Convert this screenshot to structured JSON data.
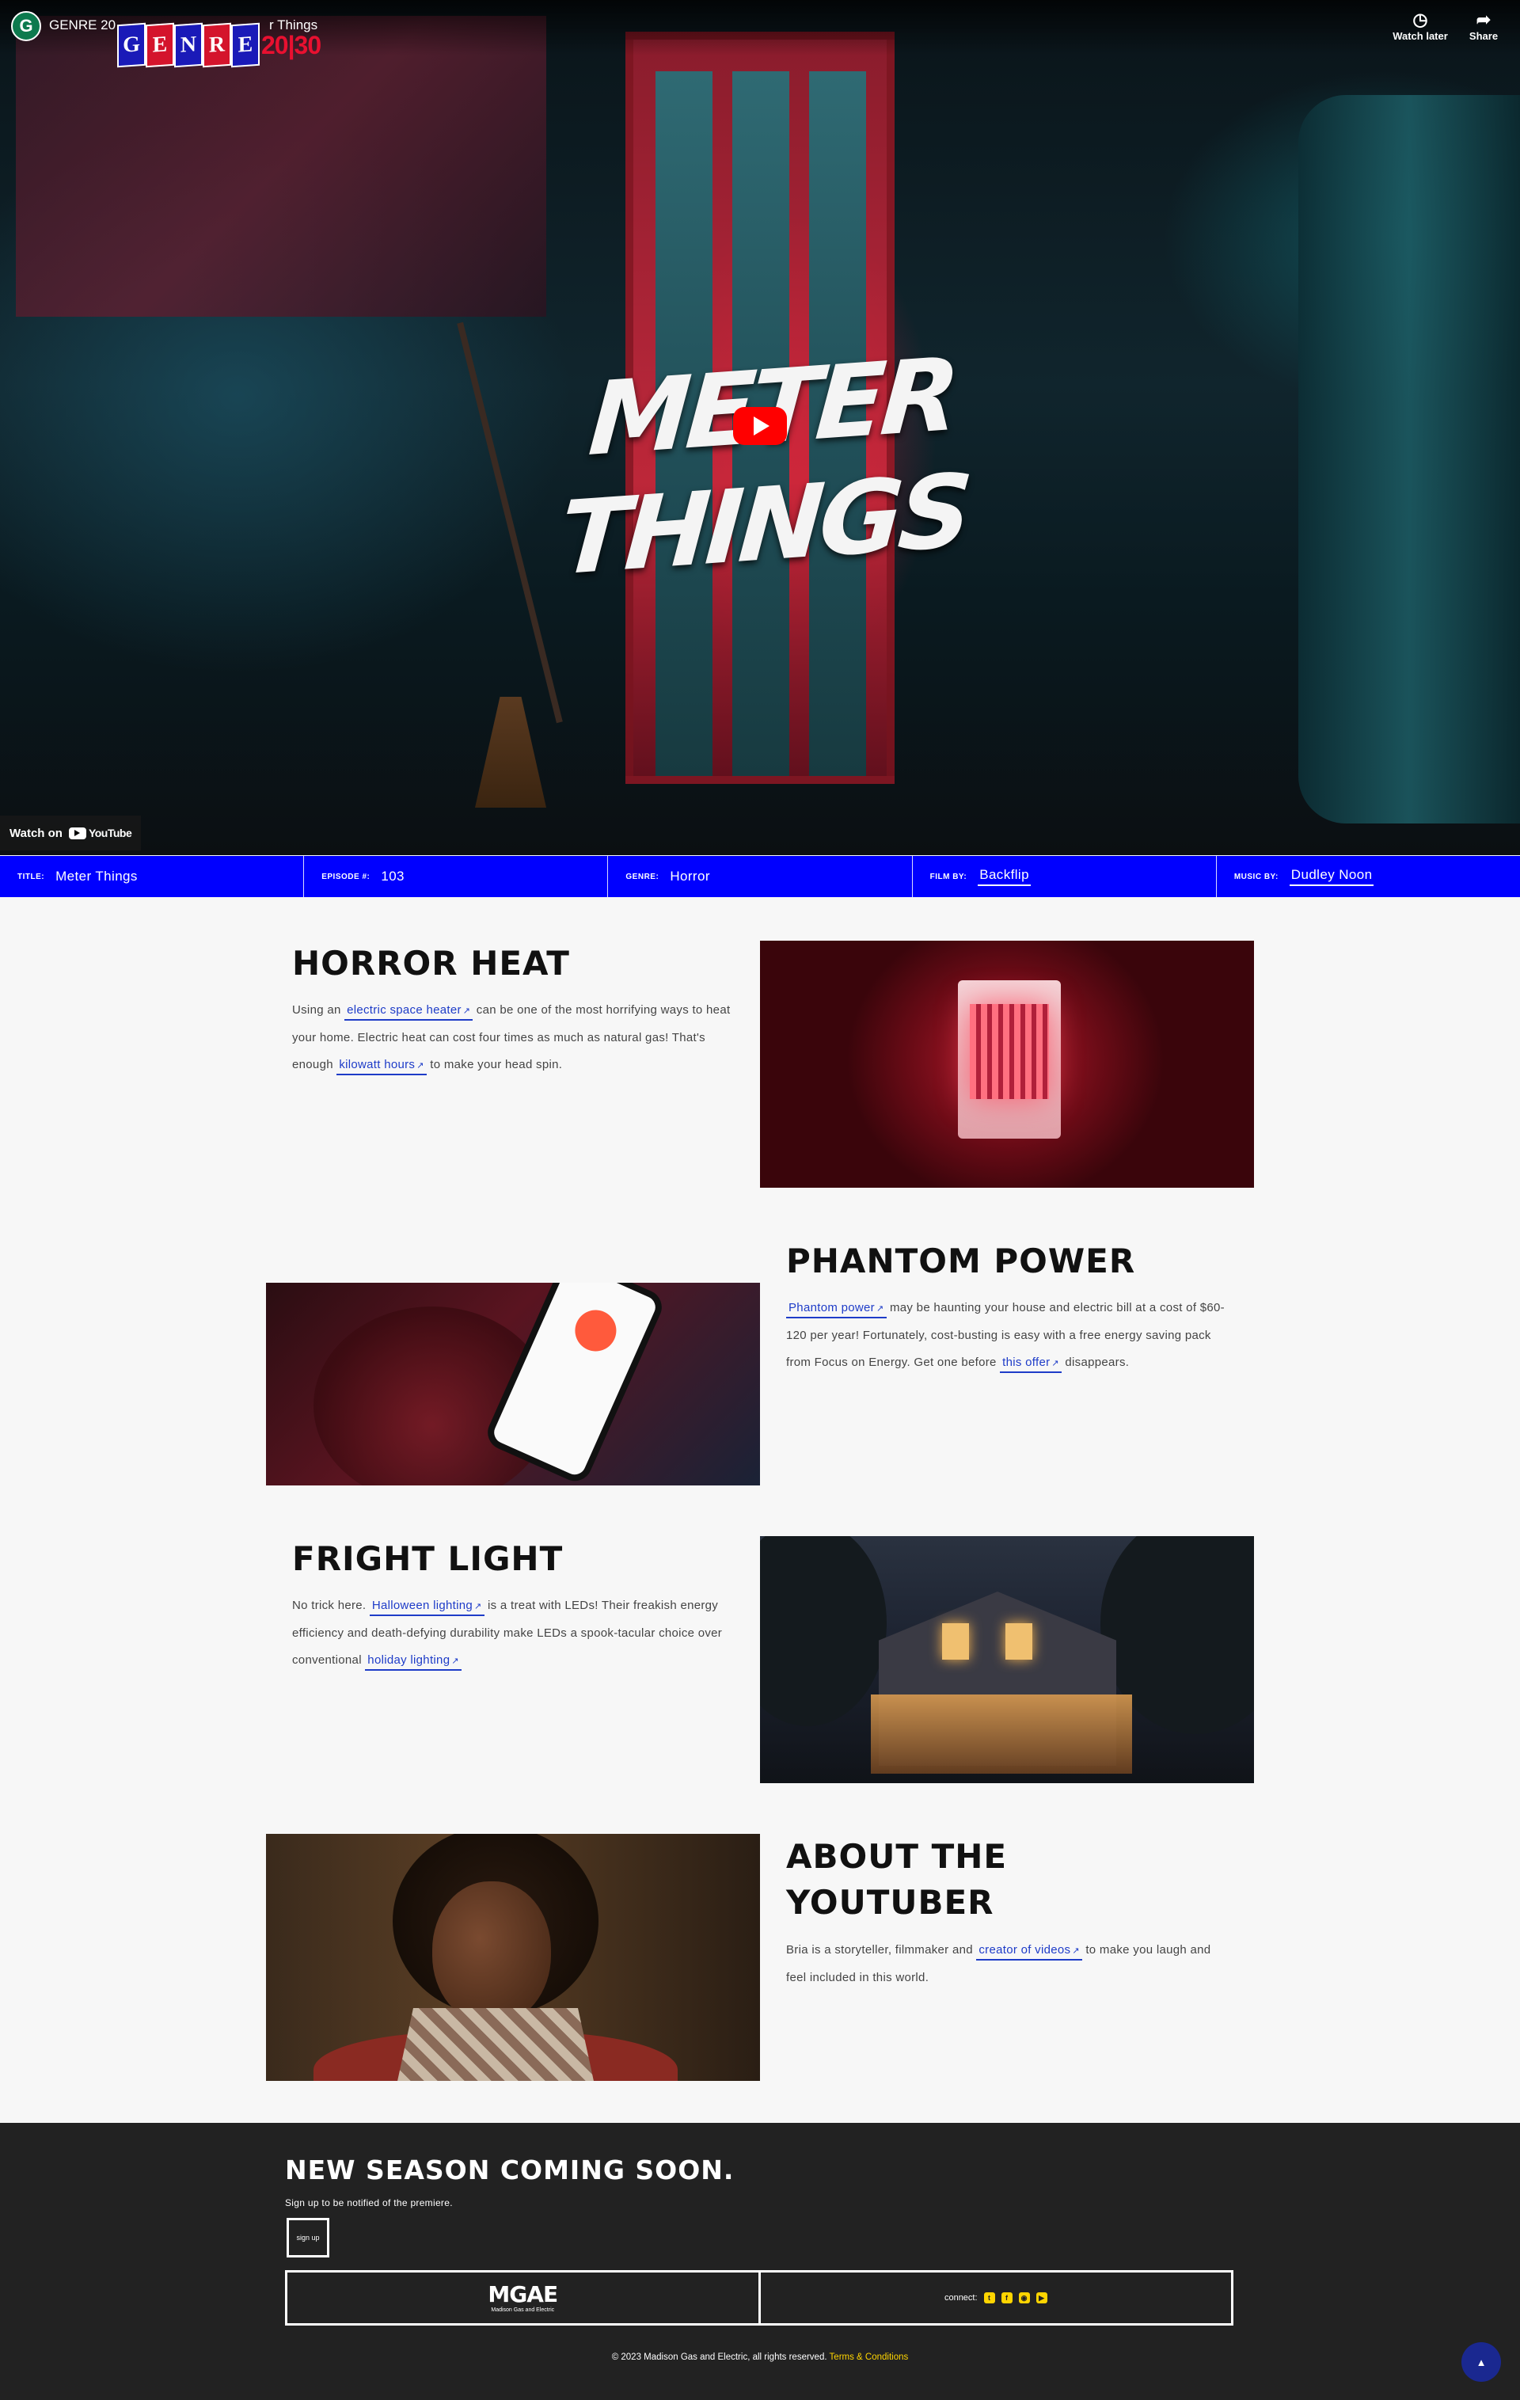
{
  "video": {
    "channel_initial": "G",
    "title_prefix": "GENRE 20",
    "title_suffix": "r Things",
    "genre_logo_letters": [
      "G",
      "E",
      "N",
      "R",
      "E"
    ],
    "genre_logo_year": "20|30",
    "watch_later": "Watch later",
    "share": "Share",
    "overlay_title": "METER THINGS",
    "watch_on": "Watch on",
    "youtube": "YouTube"
  },
  "info_bar": [
    {
      "label": "TITLE:",
      "value": "Meter Things",
      "is_link": false
    },
    {
      "label": "EPISODE #:",
      "value": "103",
      "is_link": false
    },
    {
      "label": "GENRE:",
      "value": "Horror",
      "is_link": false
    },
    {
      "label": "FILM BY:",
      "value": "Backflip",
      "is_link": true
    },
    {
      "label": "MUSIC BY:",
      "value": "Dudley Noon",
      "is_link": true
    }
  ],
  "sections": {
    "horror_heat": {
      "heading": "HORROR HEAT",
      "t1": "Using an ",
      "link1": "electric space heater",
      "t2": " can be one of the most horrifying ways to heat your home. Electric heat can cost four times as much as natural gas! That's enough ",
      "link2": "kilowatt hours",
      "t3": " to make your head spin."
    },
    "phantom_power": {
      "heading": "PHANTOM POWER",
      "link1": "Phantom power",
      "t1": " may be haunting your house and electric bill at a cost of $60-120 per year! Fortunately, cost-busting is easy with a free energy saving pack from Focus on Energy. Get one before ",
      "link2": "this offer",
      "t2": " disappears."
    },
    "fright_light": {
      "heading": "FRIGHT LIGHT",
      "t1": "No trick here. ",
      "link1": "Halloween lighting",
      "t2": " is a treat with LEDs! Their freakish energy efficiency and death-defying durability make LEDs a spook-tacular choice over conventional ",
      "link2": "holiday lighting",
      "t3": ""
    },
    "about": {
      "heading_line1": "ABOUT THE",
      "heading_line2": "YOUTUBER",
      "t1": "Bria is a storyteller, filmmaker and ",
      "link1": "creator of videos",
      "t2": " to make you laugh and feel included in this world."
    }
  },
  "footer": {
    "heading": "NEW SEASON COMING SOON.",
    "sub": "Sign up to be notified of the premiere.",
    "signup": "sign up",
    "logo": "MGAE",
    "logo_tag": "Madison Gas and Electric",
    "connect": "connect:",
    "copyright": "© 2023 Madison Gas and Electric, all rights reserved.",
    "terms": "Terms & Conditions"
  },
  "colors": {
    "info_bar": "#0000ff",
    "link": "#1e3cc8",
    "footer_bg": "#222222",
    "accent_yellow": "#ffd500",
    "play_red": "#ff0000"
  },
  "icons": [
    "channel-avatar",
    "clock-icon",
    "share-icon",
    "play-icon",
    "youtube-icon",
    "external-link-icon",
    "twitter-icon",
    "facebook-icon",
    "instagram-icon",
    "youtube-small-icon",
    "arrow-up-icon"
  ]
}
